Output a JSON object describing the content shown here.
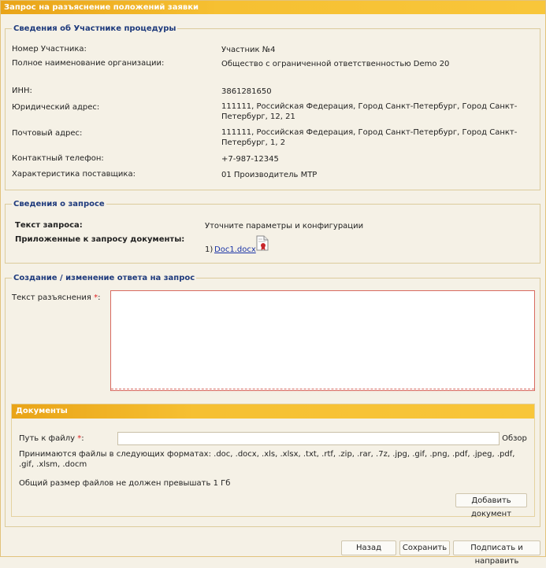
{
  "window": {
    "title": "Запрос на разъяснение положений заявки"
  },
  "participant": {
    "legend": "Сведения об Участнике процедуры",
    "rows": [
      {
        "label": "Номер Участника:",
        "value": "Участник №4"
      },
      {
        "label": "Полное наименование организации:",
        "value": "Общество с ограниченной ответственностью Demo 20"
      },
      {
        "label": "ИНН:",
        "value": "3861281650"
      },
      {
        "label": "Юридический адрес:",
        "value": "111111, Российская Федерация, Город Санкт-Петербург, Город Санкт-Петербург, 12, 21"
      },
      {
        "label": "Почтовый адрес:",
        "value": "111111, Российская Федерация, Город Санкт-Петербург, Город Санкт-Петербург, 1, 2"
      },
      {
        "label": "Контактный телефон:",
        "value": "+7-987-12345"
      },
      {
        "label": "Характеристика поставщика:",
        "value": "01 Производитель МТР"
      }
    ]
  },
  "request": {
    "legend": "Сведения о запросе",
    "text_label": "Текст запроса:",
    "text_value": "Уточните параметры и конфигурации",
    "docs_label": "Приложенные к запросу документы:",
    "doc_index": "1)",
    "doc_name": "Doc1.docx",
    "doc_icon": "document-certificate-icon"
  },
  "answer": {
    "legend": "Создание / изменение ответа на запрос",
    "text_label": "Текст разъяснения",
    "required_mark": "*",
    "colon": ":",
    "text_value": ""
  },
  "documents": {
    "header": "Документы",
    "path_label": "Путь к файлу",
    "required_mark": "*",
    "colon": ":",
    "path_value": "",
    "browse_label": "Обзор",
    "formats_note": "Принимаются файлы в следующих форматах: .doc, .docx, .xls, .xlsx, .txt, .rtf, .zip, .rar, .7z, .jpg, .gif, .png, .pdf, .jpeg, .pdf, .gif, .xlsm, .docm",
    "size_note": "Общий размер файлов не должен превышать 1 Гб",
    "add_label": "Добавить документ"
  },
  "footer": {
    "back_label": "Назад",
    "save_label": "Сохранить",
    "sign_label": "Подписать и направить"
  },
  "colors": {
    "accent": "#f6c032",
    "legend_text": "#1e3a7c",
    "required": "#d22222",
    "link": "#1a33a6"
  }
}
